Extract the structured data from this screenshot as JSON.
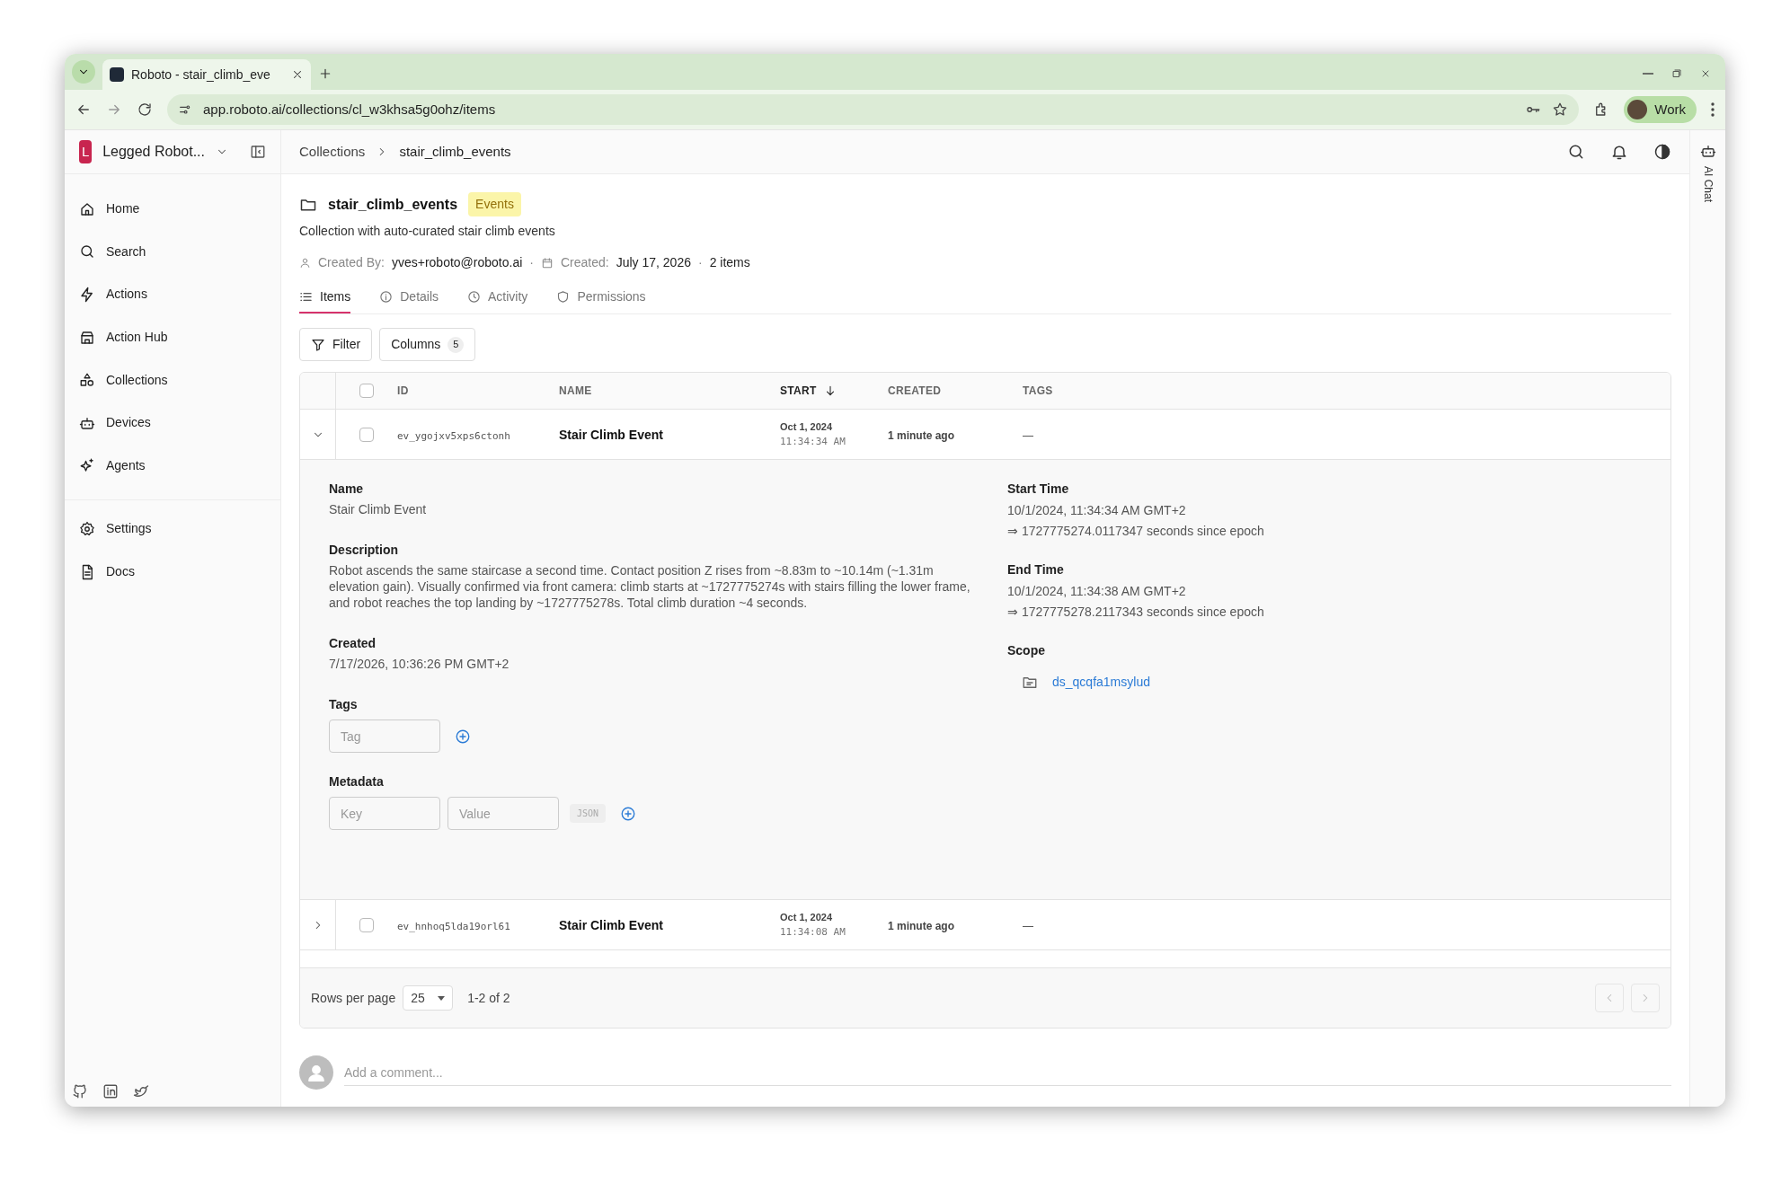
{
  "browser": {
    "tab_title": "Roboto - stair_climb_eve",
    "url": "app.roboto.ai/collections/cl_w3khsa5g0ohz/items",
    "profile": "Work"
  },
  "sidebar": {
    "org_initial": "L",
    "org_name": "Legged Robot...",
    "items": [
      {
        "label": "Home"
      },
      {
        "label": "Search"
      },
      {
        "label": "Actions"
      },
      {
        "label": "Action Hub"
      },
      {
        "label": "Collections"
      },
      {
        "label": "Devices"
      },
      {
        "label": "Agents"
      }
    ],
    "bottom_items": [
      {
        "label": "Settings"
      },
      {
        "label": "Docs"
      }
    ]
  },
  "breadcrumb": [
    "Collections",
    "stair_climb_events"
  ],
  "collection": {
    "name": "stair_climb_events",
    "badge": "Events",
    "description": "Collection with auto-curated stair climb events",
    "created_by_label": "Created By:",
    "created_by": "yves+roboto@roboto.ai",
    "created_label": "Created:",
    "created": "July 17, 2026",
    "count": "2 items",
    "separator": "·"
  },
  "tabs": [
    {
      "label": "Items",
      "selected": true
    },
    {
      "label": "Details",
      "selected": false
    },
    {
      "label": "Activity",
      "selected": false
    },
    {
      "label": "Permissions",
      "selected": false
    }
  ],
  "toolbar": {
    "filter": "Filter",
    "columns": "Columns",
    "columns_count": "5"
  },
  "table": {
    "select_all_checked": false,
    "columns": [
      {
        "label": "ID",
        "sorted": false
      },
      {
        "label": "NAME",
        "sorted": false
      },
      {
        "label": "START",
        "sorted": true
      },
      {
        "label": "CREATED",
        "sorted": false
      },
      {
        "label": "TAGS",
        "sorted": false
      }
    ],
    "rows": [
      {
        "expanded": true,
        "checked": false,
        "id": "ev_ygojxv5xps6ctonh",
        "name": "Stair Climb Event",
        "start_date": "Oct 1, 2024",
        "start_time": "11:34:34 AM",
        "created": "1 minute ago",
        "tags": "—",
        "details": {
          "left": [
            {
              "label": "Name",
              "value": "Stair Climb Event"
            },
            {
              "label": "Description",
              "value": "Robot ascends the same staircase a second time. Contact position Z rises from ~8.83m to ~10.14m (~1.31m elevation gain). Visually confirmed via front camera: climb starts at ~1727775274s with stairs filling the lower frame, and robot reaches the top landing by ~1727775278s. Total climb duration ~4 seconds."
            },
            {
              "label": "Created",
              "value": "7/17/2026, 10:36:26 PM GMT+2"
            }
          ],
          "tags_label": "Tags",
          "tag_placeholder": "Tag",
          "metadata_label": "Metadata",
          "key_placeholder": "Key",
          "value_placeholder": "Value",
          "json_label": "JSON",
          "right": [
            {
              "label": "Start Time",
              "value": "10/1/2024, 11:34:34 AM GMT+2",
              "epoch": "⇒ 1727775274.0117347 seconds since epoch"
            },
            {
              "label": "End Time",
              "value": "10/1/2024, 11:34:38 AM GMT+2",
              "epoch": "⇒ 1727775278.2117343 seconds since epoch"
            }
          ],
          "scope_label": "Scope",
          "scope": "ds_qcqfa1msylud"
        }
      },
      {
        "expanded": false,
        "checked": false,
        "id": "ev_hnhoq5lda19orl61",
        "name": "Stair Climb Event",
        "start_date": "Oct 1, 2024",
        "start_time": "11:34:08 AM",
        "created": "1 minute ago",
        "tags": "—"
      }
    ]
  },
  "pagination": {
    "rows_per_page_label": "Rows per page",
    "rows_per_page": "25",
    "range": "1-2 of 2"
  },
  "comment": {
    "placeholder": "Add a comment..."
  },
  "ai_chat": "AI Chat"
}
